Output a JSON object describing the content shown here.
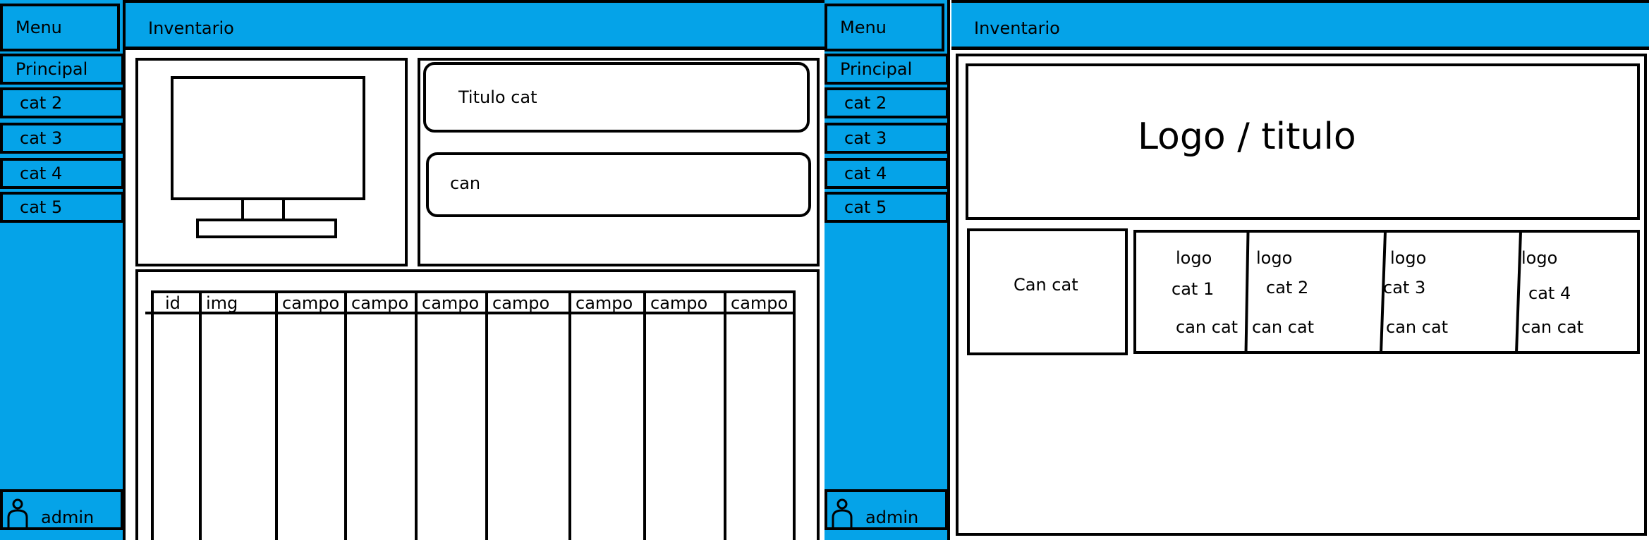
{
  "colors": {
    "accent": "#05a3e8",
    "outline": "#000000",
    "panel": "#ffffff"
  },
  "screen_left": {
    "sidebar": {
      "menu_title": "Menu",
      "items": [
        {
          "label": "Principal"
        },
        {
          "label": "cat 2"
        },
        {
          "label": "cat 3"
        },
        {
          "label": "cat 4"
        },
        {
          "label": "cat 5"
        }
      ],
      "user": {
        "label": "admin",
        "icon": "user-icon"
      }
    },
    "header": {
      "title": "Inventario"
    },
    "detail": {
      "image_icon": "monitor-icon",
      "title_field": "Titulo cat",
      "quantity_field": "can"
    },
    "table": {
      "columns": [
        "id",
        "img",
        "campo",
        "campo",
        "campo",
        "campo",
        "campo",
        "campo",
        "campo"
      ]
    }
  },
  "screen_right": {
    "sidebar": {
      "menu_title": "Menu",
      "items": [
        {
          "label": "Principal"
        },
        {
          "label": "cat 2"
        },
        {
          "label": "cat 3"
        },
        {
          "label": "cat 4"
        },
        {
          "label": "cat 5"
        }
      ],
      "user": {
        "label": "admin",
        "icon": "user-icon"
      }
    },
    "header": {
      "title": "Inventario"
    },
    "banner": {
      "text": "Logo / titulo"
    },
    "summary": {
      "label": "Can cat"
    },
    "categories": [
      {
        "logo": "logo",
        "name": "cat 1",
        "count": "can cat"
      },
      {
        "logo": "logo",
        "name": "cat 2",
        "count": "can cat"
      },
      {
        "logo": "logo",
        "name": "cat 3",
        "count": "can cat"
      },
      {
        "logo": "logo",
        "name": "cat 4",
        "count": "can cat"
      }
    ]
  }
}
